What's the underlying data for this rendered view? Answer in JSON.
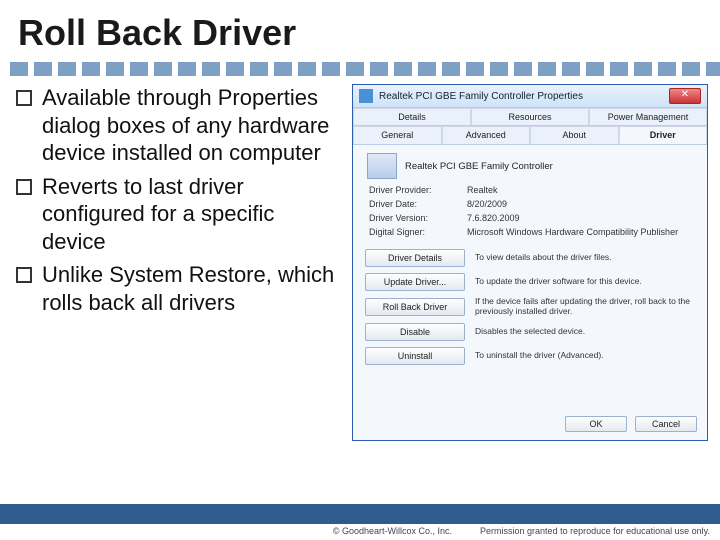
{
  "title": "Roll Back Driver",
  "bullets": [
    "Available through Properties dialog boxes of any hardware device installed on computer",
    "Reverts to last driver configured for a specific device",
    "Unlike System Restore, which rolls back all drivers"
  ],
  "dialog": {
    "window_title": "Realtek PCI GBE Family Controller Properties",
    "close_glyph": "✕",
    "tabs_row1": [
      "Details",
      "Resources",
      "Power Management"
    ],
    "tabs_row2": [
      "General",
      "Advanced",
      "About",
      "Driver"
    ],
    "device_name": "Realtek PCI GBE Family Controller",
    "info": {
      "provider_label": "Driver Provider:",
      "provider": "Realtek",
      "date_label": "Driver Date:",
      "date": "8/20/2009",
      "version_label": "Driver Version:",
      "version": "7.6.820.2009",
      "signer_label": "Digital Signer:",
      "signer": "Microsoft Windows Hardware Compatibility Publisher"
    },
    "buttons": [
      {
        "label": "Driver Details",
        "desc": "To view details about the driver files."
      },
      {
        "label": "Update Driver...",
        "desc": "To update the driver software for this device."
      },
      {
        "label": "Roll Back Driver",
        "desc": "If the device fails after updating the driver, roll back to the previously installed driver."
      },
      {
        "label": "Disable",
        "desc": "Disables the selected device."
      },
      {
        "label": "Uninstall",
        "desc": "To uninstall the driver (Advanced)."
      }
    ],
    "ok": "OK",
    "cancel": "Cancel"
  },
  "footer": {
    "copyright": "© Goodheart-Willcox Co., Inc.",
    "permission": "Permission granted to reproduce for educational use only."
  }
}
